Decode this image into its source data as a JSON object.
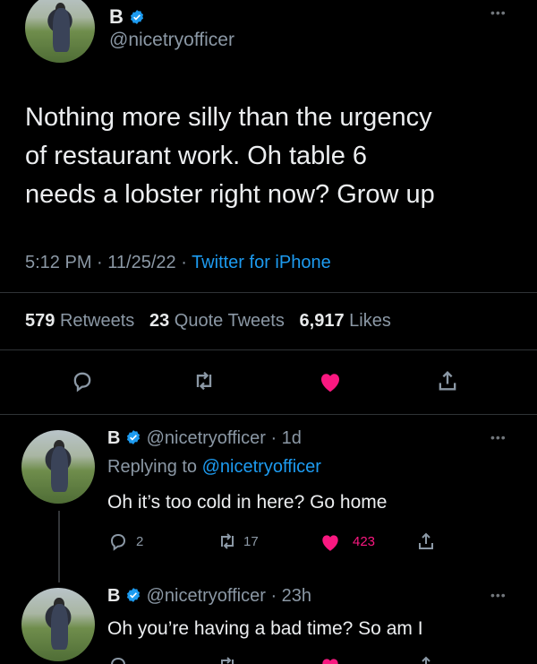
{
  "main_tweet": {
    "display_name": "B",
    "handle": "@nicetryofficer",
    "text_lines": [
      "Nothing more silly than the urgency",
      "of restaurant work. Oh table 6",
      "needs a lobster right now? Grow up"
    ],
    "time": "5:12 PM",
    "date": "11/25/22",
    "source": "Twitter for iPhone",
    "retweets_count": "579",
    "retweets_label": "Retweets",
    "quotes_count": "23",
    "quotes_label": "Quote Tweets",
    "likes_count": "6,917",
    "likes_label": "Likes"
  },
  "reply1": {
    "display_name": "B",
    "handle": "@nicetryofficer",
    "age": "1d",
    "replying_prefix": "Replying to",
    "replying_to": "@nicetryofficer",
    "text": "Oh it’s too cold in here? Go home",
    "reply_count": "2",
    "retweet_count": "17",
    "like_count": "423"
  },
  "reply2": {
    "display_name": "B",
    "handle": "@nicetryofficer",
    "age": "23h",
    "text": "Oh you’re having a bad time? So am I"
  },
  "colors": {
    "background": "#000000",
    "text": "#e7e9ea",
    "muted": "#8b98a5",
    "link": "#1d9bf0",
    "like": "#f91880",
    "verified": "#1d9bf0"
  },
  "icons": [
    "verified-badge-icon",
    "more-options-icon",
    "reply-icon",
    "retweet-icon",
    "like-icon",
    "share-icon"
  ]
}
